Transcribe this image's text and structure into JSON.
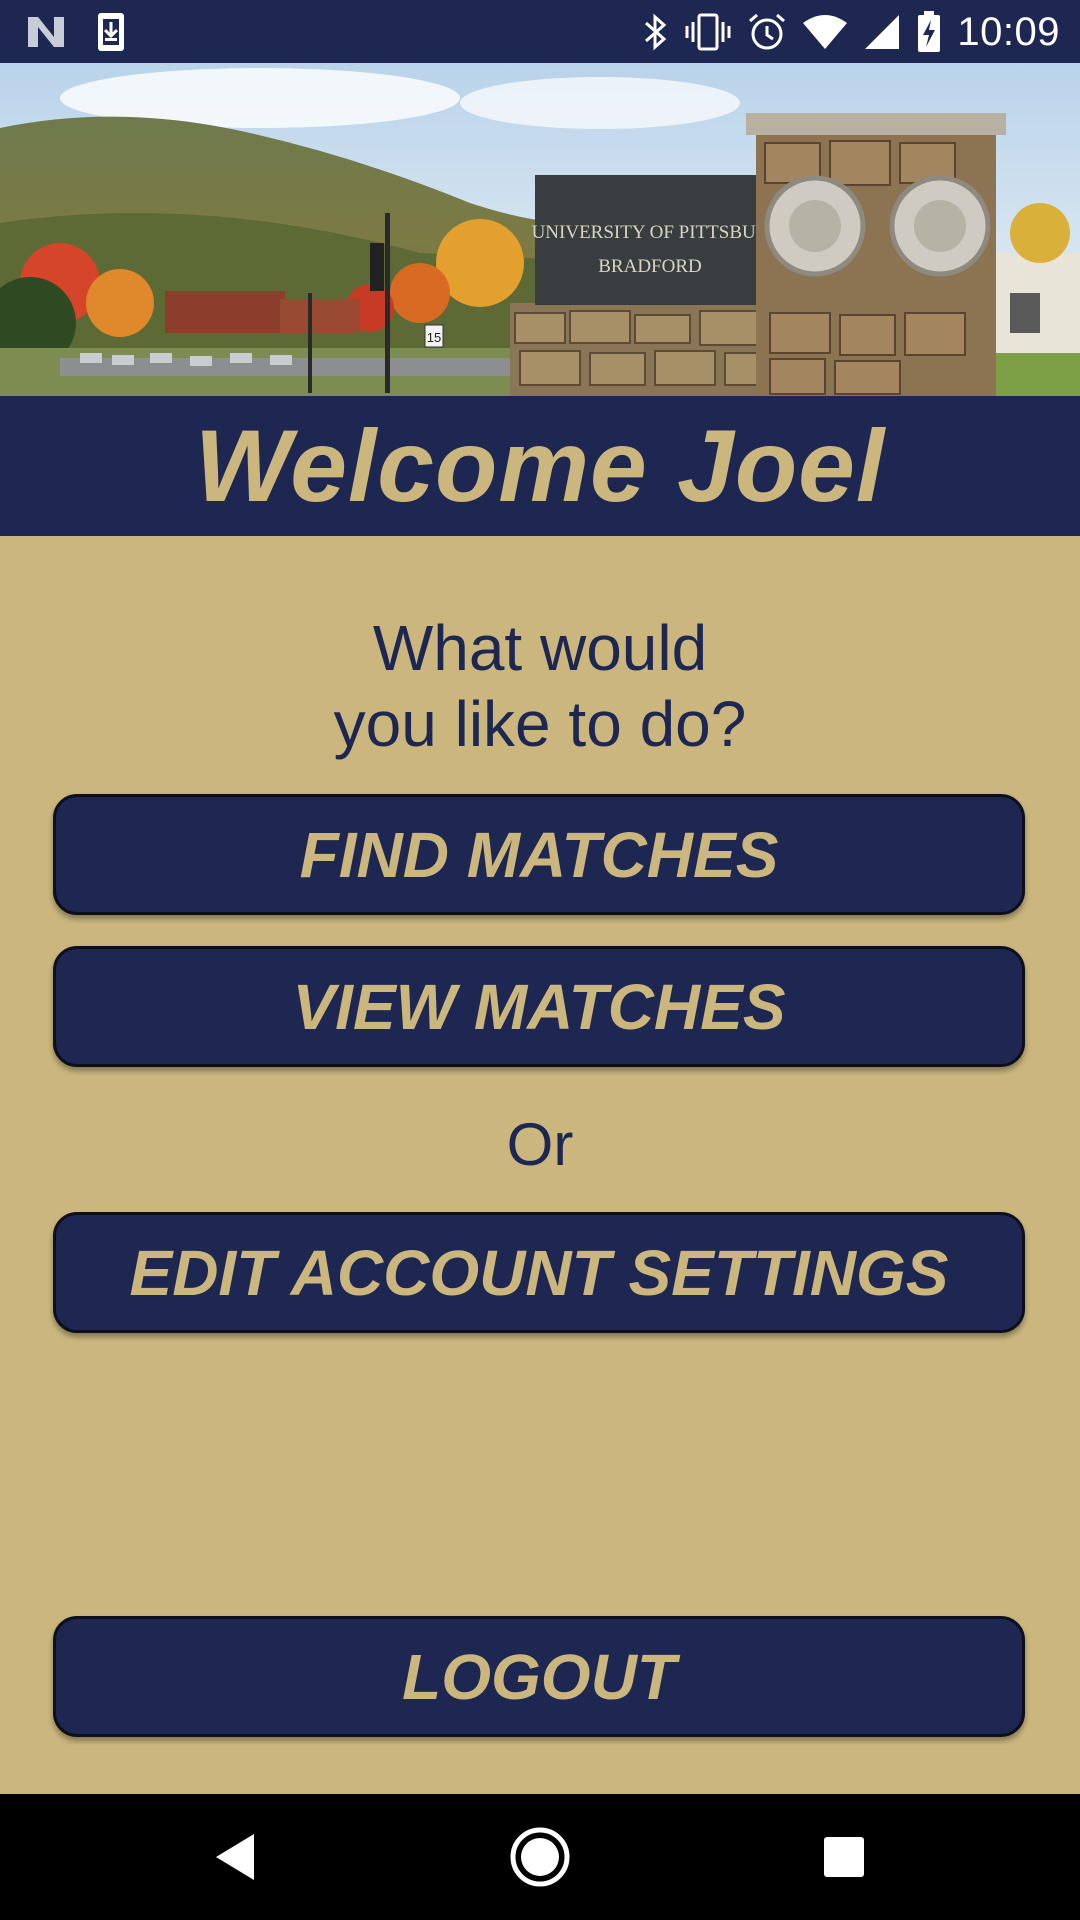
{
  "status_bar": {
    "time": "10:09",
    "left_icons": [
      "notification-n-icon",
      "download-icon"
    ],
    "right_icons": [
      "bluetooth-icon",
      "vibrate-icon",
      "alarm-icon",
      "wifi-icon",
      "signal-icon",
      "battery-charging-icon"
    ]
  },
  "banner": {
    "sign_line1": "UNIVERSITY OF PITTSBUR",
    "sign_line2": "BRADFORD",
    "road_sign": "15"
  },
  "header": {
    "title": "Welcome Joel"
  },
  "main": {
    "prompt_line1": "What would",
    "prompt_line2": "you like to do?",
    "find_label": "FIND MATCHES",
    "view_label": "VIEW MATCHES",
    "or_label": "Or",
    "edit_label": "EDIT ACCOUNT SETTINGS",
    "logout_label": "LOGOUT"
  },
  "nav": {
    "icons": [
      "back-icon",
      "home-icon",
      "recents-icon"
    ]
  },
  "colors": {
    "navy": "#1e2752",
    "gold": "#cbb77e",
    "nav_bg": "#000000"
  }
}
